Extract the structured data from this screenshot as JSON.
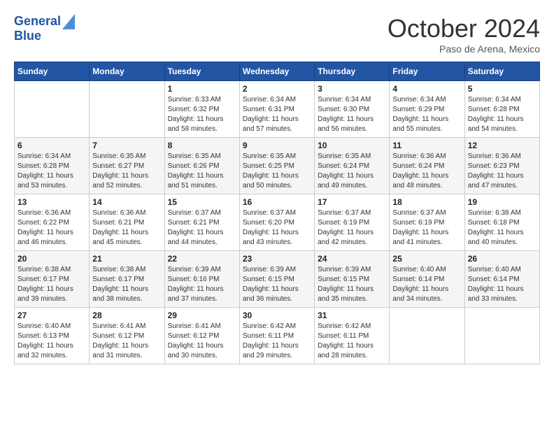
{
  "header": {
    "logo_line1": "General",
    "logo_line2": "Blue",
    "month": "October 2024",
    "location": "Paso de Arena, Mexico"
  },
  "weekdays": [
    "Sunday",
    "Monday",
    "Tuesday",
    "Wednesday",
    "Thursday",
    "Friday",
    "Saturday"
  ],
  "weeks": [
    [
      {
        "day": "",
        "sunrise": "",
        "sunset": "",
        "daylight": ""
      },
      {
        "day": "",
        "sunrise": "",
        "sunset": "",
        "daylight": ""
      },
      {
        "day": "1",
        "sunrise": "Sunrise: 6:33 AM",
        "sunset": "Sunset: 6:32 PM",
        "daylight": "Daylight: 11 hours and 58 minutes."
      },
      {
        "day": "2",
        "sunrise": "Sunrise: 6:34 AM",
        "sunset": "Sunset: 6:31 PM",
        "daylight": "Daylight: 11 hours and 57 minutes."
      },
      {
        "day": "3",
        "sunrise": "Sunrise: 6:34 AM",
        "sunset": "Sunset: 6:30 PM",
        "daylight": "Daylight: 11 hours and 56 minutes."
      },
      {
        "day": "4",
        "sunrise": "Sunrise: 6:34 AM",
        "sunset": "Sunset: 6:29 PM",
        "daylight": "Daylight: 11 hours and 55 minutes."
      },
      {
        "day": "5",
        "sunrise": "Sunrise: 6:34 AM",
        "sunset": "Sunset: 6:28 PM",
        "daylight": "Daylight: 11 hours and 54 minutes."
      }
    ],
    [
      {
        "day": "6",
        "sunrise": "Sunrise: 6:34 AM",
        "sunset": "Sunset: 6:28 PM",
        "daylight": "Daylight: 11 hours and 53 minutes."
      },
      {
        "day": "7",
        "sunrise": "Sunrise: 6:35 AM",
        "sunset": "Sunset: 6:27 PM",
        "daylight": "Daylight: 11 hours and 52 minutes."
      },
      {
        "day": "8",
        "sunrise": "Sunrise: 6:35 AM",
        "sunset": "Sunset: 6:26 PM",
        "daylight": "Daylight: 11 hours and 51 minutes."
      },
      {
        "day": "9",
        "sunrise": "Sunrise: 6:35 AM",
        "sunset": "Sunset: 6:25 PM",
        "daylight": "Daylight: 11 hours and 50 minutes."
      },
      {
        "day": "10",
        "sunrise": "Sunrise: 6:35 AM",
        "sunset": "Sunset: 6:24 PM",
        "daylight": "Daylight: 11 hours and 49 minutes."
      },
      {
        "day": "11",
        "sunrise": "Sunrise: 6:36 AM",
        "sunset": "Sunset: 6:24 PM",
        "daylight": "Daylight: 11 hours and 48 minutes."
      },
      {
        "day": "12",
        "sunrise": "Sunrise: 6:36 AM",
        "sunset": "Sunset: 6:23 PM",
        "daylight": "Daylight: 11 hours and 47 minutes."
      }
    ],
    [
      {
        "day": "13",
        "sunrise": "Sunrise: 6:36 AM",
        "sunset": "Sunset: 6:22 PM",
        "daylight": "Daylight: 11 hours and 46 minutes."
      },
      {
        "day": "14",
        "sunrise": "Sunrise: 6:36 AM",
        "sunset": "Sunset: 6:21 PM",
        "daylight": "Daylight: 11 hours and 45 minutes."
      },
      {
        "day": "15",
        "sunrise": "Sunrise: 6:37 AM",
        "sunset": "Sunset: 6:21 PM",
        "daylight": "Daylight: 11 hours and 44 minutes."
      },
      {
        "day": "16",
        "sunrise": "Sunrise: 6:37 AM",
        "sunset": "Sunset: 6:20 PM",
        "daylight": "Daylight: 11 hours and 43 minutes."
      },
      {
        "day": "17",
        "sunrise": "Sunrise: 6:37 AM",
        "sunset": "Sunset: 6:19 PM",
        "daylight": "Daylight: 11 hours and 42 minutes."
      },
      {
        "day": "18",
        "sunrise": "Sunrise: 6:37 AM",
        "sunset": "Sunset: 6:19 PM",
        "daylight": "Daylight: 11 hours and 41 minutes."
      },
      {
        "day": "19",
        "sunrise": "Sunrise: 6:38 AM",
        "sunset": "Sunset: 6:18 PM",
        "daylight": "Daylight: 11 hours and 40 minutes."
      }
    ],
    [
      {
        "day": "20",
        "sunrise": "Sunrise: 6:38 AM",
        "sunset": "Sunset: 6:17 PM",
        "daylight": "Daylight: 11 hours and 39 minutes."
      },
      {
        "day": "21",
        "sunrise": "Sunrise: 6:38 AM",
        "sunset": "Sunset: 6:17 PM",
        "daylight": "Daylight: 11 hours and 38 minutes."
      },
      {
        "day": "22",
        "sunrise": "Sunrise: 6:39 AM",
        "sunset": "Sunset: 6:16 PM",
        "daylight": "Daylight: 11 hours and 37 minutes."
      },
      {
        "day": "23",
        "sunrise": "Sunrise: 6:39 AM",
        "sunset": "Sunset: 6:15 PM",
        "daylight": "Daylight: 11 hours and 36 minutes."
      },
      {
        "day": "24",
        "sunrise": "Sunrise: 6:39 AM",
        "sunset": "Sunset: 6:15 PM",
        "daylight": "Daylight: 11 hours and 35 minutes."
      },
      {
        "day": "25",
        "sunrise": "Sunrise: 6:40 AM",
        "sunset": "Sunset: 6:14 PM",
        "daylight": "Daylight: 11 hours and 34 minutes."
      },
      {
        "day": "26",
        "sunrise": "Sunrise: 6:40 AM",
        "sunset": "Sunset: 6:14 PM",
        "daylight": "Daylight: 11 hours and 33 minutes."
      }
    ],
    [
      {
        "day": "27",
        "sunrise": "Sunrise: 6:40 AM",
        "sunset": "Sunset: 6:13 PM",
        "daylight": "Daylight: 11 hours and 32 minutes."
      },
      {
        "day": "28",
        "sunrise": "Sunrise: 6:41 AM",
        "sunset": "Sunset: 6:12 PM",
        "daylight": "Daylight: 11 hours and 31 minutes."
      },
      {
        "day": "29",
        "sunrise": "Sunrise: 6:41 AM",
        "sunset": "Sunset: 6:12 PM",
        "daylight": "Daylight: 11 hours and 30 minutes."
      },
      {
        "day": "30",
        "sunrise": "Sunrise: 6:42 AM",
        "sunset": "Sunset: 6:11 PM",
        "daylight": "Daylight: 11 hours and 29 minutes."
      },
      {
        "day": "31",
        "sunrise": "Sunrise: 6:42 AM",
        "sunset": "Sunset: 6:11 PM",
        "daylight": "Daylight: 11 hours and 28 minutes."
      },
      {
        "day": "",
        "sunrise": "",
        "sunset": "",
        "daylight": ""
      },
      {
        "day": "",
        "sunrise": "",
        "sunset": "",
        "daylight": ""
      }
    ]
  ]
}
